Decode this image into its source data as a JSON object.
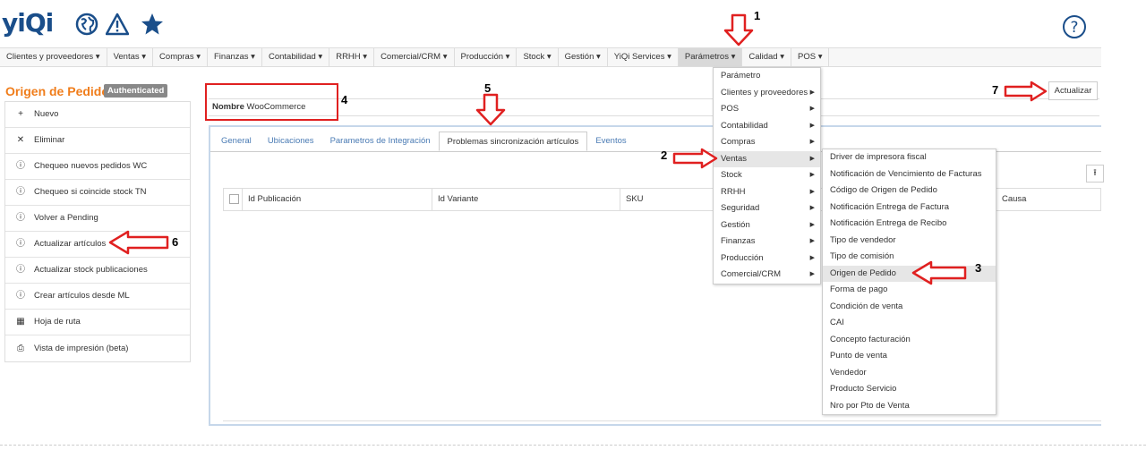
{
  "app": {
    "logo_text": "yiQi",
    "colors": {
      "brand": "#1a4e8a",
      "title_orange": "#f07d1b",
      "annotation_red": "#e02020",
      "link_blue": "#4a7bb4"
    }
  },
  "top_icons": [
    "globe-icon",
    "warning-icon",
    "star-icon",
    "help-icon"
  ],
  "menubar": [
    "Clientes y proveedores ▾",
    "Ventas ▾",
    "Compras ▾",
    "Finanzas ▾",
    "Contabilidad ▾",
    "RRHH ▾",
    "Comercial/CRM ▾",
    "Producción ▾",
    "Stock ▾",
    "Gestión ▾",
    "YiQi Services ▾",
    "Parámetros ▾",
    "Calidad ▾",
    "POS ▾"
  ],
  "page": {
    "title": "Origen de Pedido",
    "badge": "Authenticated",
    "nombre_label": "Nombre",
    "nombre_value": "WooCommerce",
    "update_button": "Actualizar"
  },
  "sidebar": [
    {
      "icon": "+",
      "label": "Nuevo"
    },
    {
      "icon": "✕",
      "label": "Eliminar"
    },
    {
      "icon": "ⓘ",
      "label": "Chequeo nuevos pedidos WC"
    },
    {
      "icon": "ⓘ",
      "label": "Chequeo si coincide stock TN"
    },
    {
      "icon": "ⓘ",
      "label": "Volver a Pending"
    },
    {
      "icon": "ⓘ",
      "label": "Actualizar artículos"
    },
    {
      "icon": "ⓘ",
      "label": "Actualizar stock publicaciones"
    },
    {
      "icon": "ⓘ",
      "label": "Crear artículos desde ML"
    },
    {
      "icon": "▦",
      "label": "Hoja de ruta"
    },
    {
      "icon": "⎙",
      "label": "Vista de impresión (beta)"
    }
  ],
  "tabs": [
    {
      "label": "General",
      "active": false
    },
    {
      "label": "Ubicaciones",
      "active": false
    },
    {
      "label": "Parametros de Integración",
      "active": false
    },
    {
      "label": "Problemas sincronización artículos",
      "active": true
    },
    {
      "label": "Eventos",
      "active": false
    }
  ],
  "grid": {
    "columns": [
      "Id Publicación",
      "Id Variante",
      "SKU",
      "Causa"
    ]
  },
  "parametros_menu": [
    {
      "label": "Parámetro",
      "sub": false
    },
    {
      "label": "Clientes y proveedores",
      "sub": true
    },
    {
      "label": "POS",
      "sub": true
    },
    {
      "label": "Contabilidad",
      "sub": true
    },
    {
      "label": "Compras",
      "sub": true
    },
    {
      "label": "Ventas",
      "sub": true,
      "highlight": true
    },
    {
      "label": "Stock",
      "sub": true
    },
    {
      "label": "RRHH",
      "sub": true
    },
    {
      "label": "Seguridad",
      "sub": true
    },
    {
      "label": "Gestión",
      "sub": true
    },
    {
      "label": "Finanzas",
      "sub": true
    },
    {
      "label": "Producción",
      "sub": true
    },
    {
      "label": "Comercial/CRM",
      "sub": true
    }
  ],
  "ventas_menu": [
    "Driver de impresora fiscal",
    "Notificación de Vencimiento de Facturas",
    "Código de Origen de Pedido",
    "Notificación Entrega de Factura",
    "Notificación Entrega de Recibo",
    "Tipo de vendedor",
    "Tipo de comisión",
    "Origen de Pedido",
    "Forma de pago",
    "Condición de venta",
    "CAI",
    "Concepto facturación",
    "Punto de venta",
    "Vendedor",
    "Producto Servicio",
    "Nro por Pto de Venta"
  ],
  "ventas_menu_highlight": 7,
  "annotations": [
    "1",
    "2",
    "3",
    "4",
    "5",
    "6",
    "7"
  ]
}
